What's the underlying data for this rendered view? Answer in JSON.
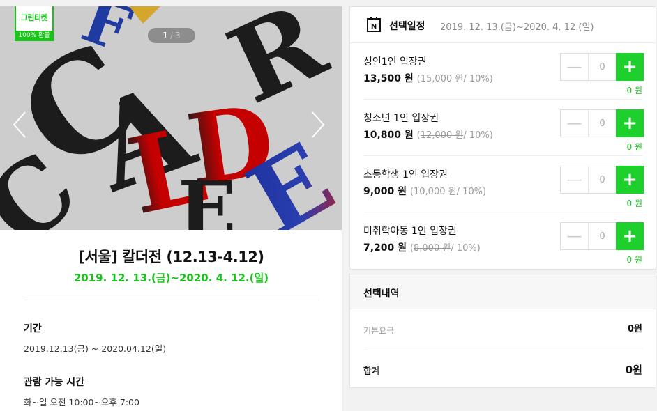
{
  "poster": {
    "badge_title": "그린티켓",
    "badge_sub": "100% 환불",
    "pager_current": "1",
    "pager_separator": "/",
    "pager_total": "3"
  },
  "event": {
    "title": "[서울] 칼더전 (12.13-4.12)",
    "dates": "2019. 12. 13.(금)~2020. 4. 12.(일)",
    "period_label": "기간",
    "period_value": "2019.12.13(금) ~ 2020.04.12(일)",
    "hours_label": "관람 가능 시간",
    "hours_value": "화~일 오전 10:00~오후 7:00"
  },
  "date_bar": {
    "label": "선택일정",
    "range": "2019. 12. 13.(금)~2020. 4. 12.(일)"
  },
  "tickets": [
    {
      "name": "성인1인 입장권",
      "price": "13,500 원",
      "paren_open": "(",
      "orig": "15,000 원",
      "discount": "/ 10%)",
      "count": "0",
      "subtotal": "0 원"
    },
    {
      "name": "청소년 1인 입장권",
      "price": "10,800 원",
      "paren_open": "(",
      "orig": "12,000 원",
      "discount": "/ 10%)",
      "count": "0",
      "subtotal": "0 원"
    },
    {
      "name": "초등학생 1인 입장권",
      "price": "9,000 원",
      "paren_open": "(",
      "orig": "10,000 원",
      "discount": "/ 10%)",
      "count": "0",
      "subtotal": "0 원"
    },
    {
      "name": "미취학아동 1인 입장권",
      "price": "7,200 원",
      "paren_open": "(",
      "orig": "8,000 원",
      "discount": "/ 10%)",
      "count": "0",
      "subtotal": "0 원"
    }
  ],
  "summary": {
    "title": "선택내역",
    "base_label": "기본요금",
    "base_value": "0원",
    "total_label": "합계",
    "total_value": "0원"
  },
  "colors": {
    "accent": "#1ed02c",
    "accent_text": "#19c31a"
  }
}
